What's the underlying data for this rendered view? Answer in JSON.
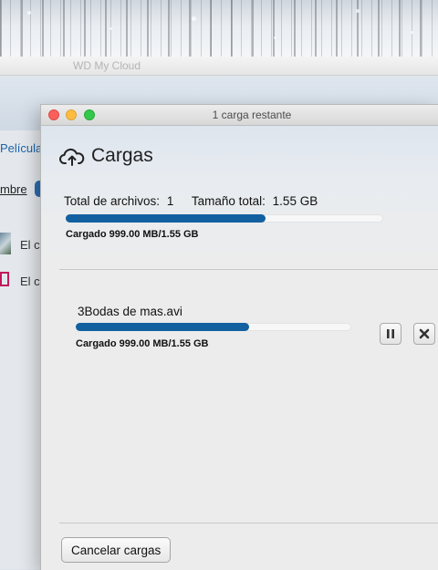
{
  "background_window": {
    "title": "WD My Cloud",
    "tab_label": "Películas",
    "sort_label": "mbre",
    "rows": [
      {
        "text": "El c"
      },
      {
        "text": "El c"
      }
    ]
  },
  "dialog": {
    "window_title": "1 carga restante",
    "heading": "Cargas",
    "heading_icon": "cloud-upload-icon",
    "totals": {
      "files_label": "Total de archivos:",
      "files_value": "1",
      "size_label": "Tamaño total:",
      "size_value": "1.55 GB",
      "progress": 0.63,
      "status": "Cargado 999.00 MB/1.55 GB"
    },
    "files": [
      {
        "name": "3Bodas de mas.avi",
        "progress": 0.63,
        "status": "Cargado 999.00 MB/1.55 GB",
        "pause_icon": "pause-icon",
        "cancel_icon": "close-icon"
      }
    ],
    "cancel_all_label": "Cancelar cargas"
  },
  "colors": {
    "progress_fill": "#1360a1",
    "link_blue": "#1d64a8",
    "traffic_red": "#fc605c",
    "traffic_yellow": "#fdbc40",
    "traffic_green": "#34c84a"
  }
}
